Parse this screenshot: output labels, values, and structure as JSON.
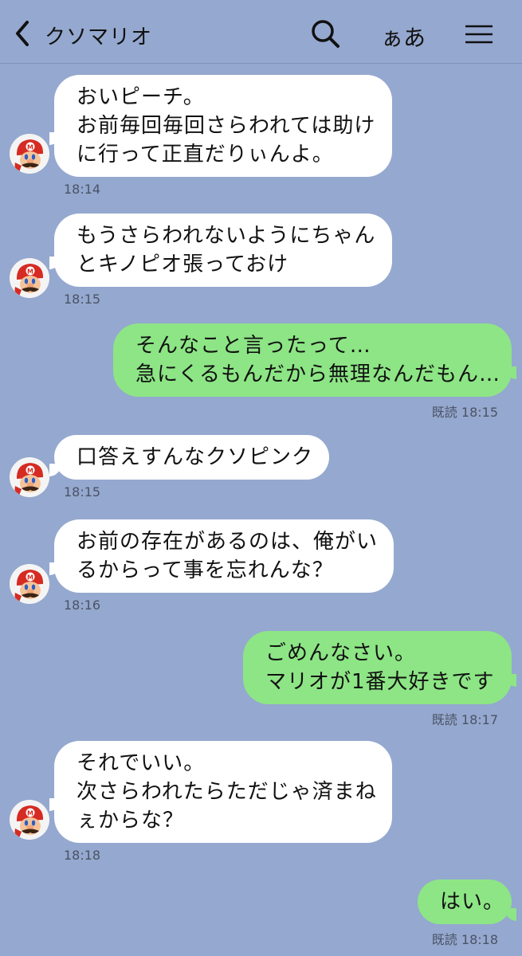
{
  "header": {
    "title": "クソマリオ",
    "font_size_label": "ぁあ",
    "icons": {
      "back": "chevron-left-icon",
      "search": "search-icon",
      "menu": "hamburger-menu-icon"
    }
  },
  "colors": {
    "background": "#95a8cf",
    "incoming_bubble": "#ffffff",
    "outgoing_bubble": "#8de585"
  },
  "messages": [
    {
      "side": "in",
      "lines": [
        "おいピーチ。",
        "お前毎回毎回さらわれては助け",
        "に行って正直だりぃんよ。"
      ],
      "time": "18:14"
    },
    {
      "side": "in",
      "lines": [
        "もうさらわれないようにちゃん",
        "とキノピオ張っておけ"
      ],
      "time": "18:15"
    },
    {
      "side": "out",
      "lines": [
        "そんなこと言ったって…",
        "急にくるもんだから無理なんだもん…"
      ],
      "read": "既読",
      "time": "18:15"
    },
    {
      "side": "in",
      "lines": [
        "口答えすんなクソピンク"
      ],
      "time": "18:15"
    },
    {
      "side": "in",
      "lines": [
        "お前の存在があるのは、俺がい",
        "るからって事を忘れんな？"
      ],
      "time": "18:16"
    },
    {
      "side": "out",
      "lines": [
        "ごめんなさい。",
        "マリオが1番大好きです"
      ],
      "read": "既読",
      "time": "18:17"
    },
    {
      "side": "in",
      "lines": [
        "それでいい。",
        "次さらわれたらただじゃ済まね",
        "ぇからな？"
      ],
      "time": "18:18"
    },
    {
      "side": "out",
      "lines": [
        "はい。"
      ],
      "read": "既読",
      "time": "18:18"
    }
  ]
}
